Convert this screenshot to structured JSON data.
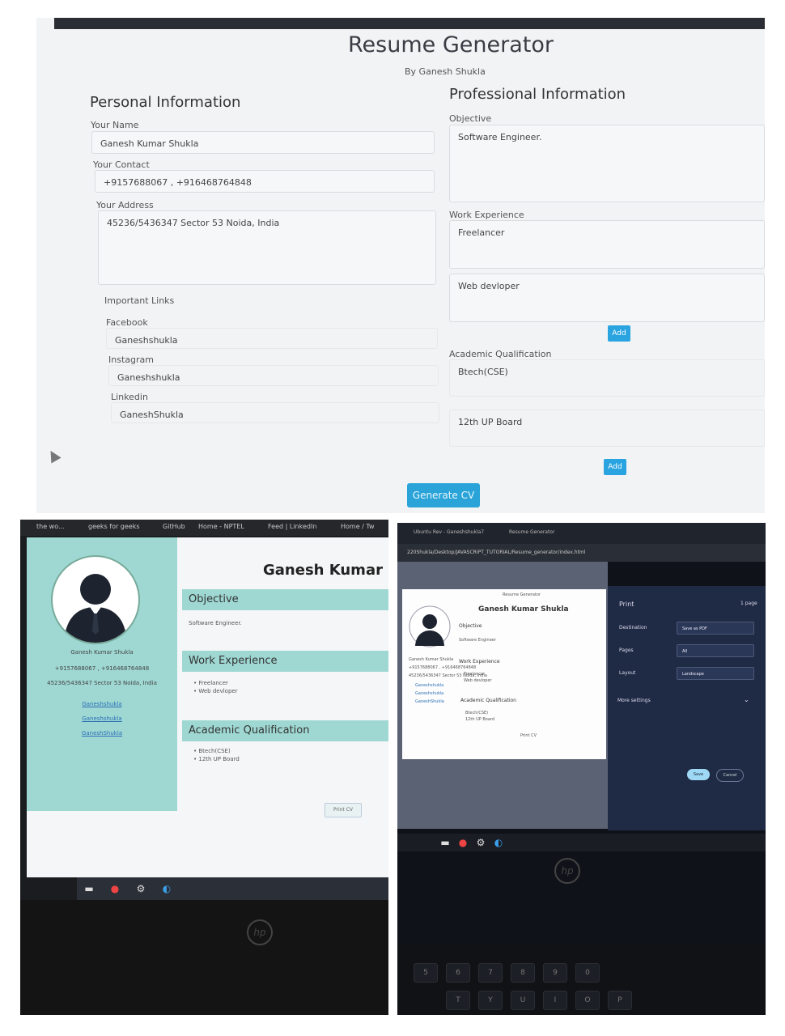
{
  "form": {
    "title": "Resume Generator",
    "subtitle": "By Ganesh Shukla",
    "personal_heading": "Personal Information",
    "professional_heading": "Professional Information",
    "name_label": "Your Name",
    "name_value": "Ganesh Kumar Shukla",
    "contact_label": "Your Contact",
    "contact_value": "+9157688067 , +916468764848",
    "address_label": "Your Address",
    "address_value": "45236/5436347 Sector 53 Noida, India",
    "links_label": "Important Links",
    "facebook_label": "Facebook",
    "facebook_value": "Ganeshshukla",
    "instagram_label": "Instagram",
    "instagram_value": "Ganeshshukla",
    "linkedin_label": "Linkedin",
    "linkedin_value": "GaneshShukla",
    "objective_label": "Objective",
    "objective_value": "Software Engineer.",
    "work_label": "Work Experience",
    "work_values": [
      "Freelancer",
      "Web devloper"
    ],
    "add_label": "Add",
    "academic_label": "Academic Qualification",
    "academic_values": [
      "Btech(CSE)",
      "12th UP Board"
    ],
    "generate_label": "Generate CV"
  },
  "cv_page": {
    "bookmarks": [
      "the wo...",
      "geeks for geeks",
      "GitHub",
      "Home - NPTEL",
      "Feed | LinkedIn",
      "Home / Tw"
    ],
    "name": "Ganesh Kumar S",
    "side_name": "Ganesh Kumar Shukla",
    "side_contact": "+9157688067 , +916468764848",
    "side_address": "45236/5436347 Sector 53 Noida, India",
    "side_links": [
      "Ganeshshukla",
      "Ganeshshukla",
      "GaneshShukla"
    ],
    "objective_heading": "Objective",
    "objective_text": "Software Engineer.",
    "work_heading": "Work Experience",
    "work_items": [
      "Freelancer",
      "Web devloper"
    ],
    "academic_heading": "Academic Qualification",
    "academic_items": [
      "Btech(CSE)",
      "12th UP Board"
    ],
    "print_label": "Print CV"
  },
  "print_dialog": {
    "tab1": "Ubuntu Rev - Ganeshshukla7",
    "tab2": "Resume Generator",
    "url": "220Shukla/Desktop/JAVASCRIPT_TUTORIAL/Resume_generator/index.html",
    "preview_title": "Resume Generator",
    "preview_name": "Ganesh Kumar Shukla",
    "preview_objective": "Objective",
    "preview_objective_text": "Software Engineer",
    "preview_work": "Work Experience",
    "preview_work_items": [
      "Freelancer",
      "Web devloper"
    ],
    "preview_academic": "Academic Qualification",
    "preview_academic_items": [
      "Btech(CSE)",
      "12th UP Board"
    ],
    "preview_side": [
      "Ganesh Kumar Shukla",
      "+9157688067 , +916468764848",
      "45236/5436347 Sector 53 Noida, India",
      "Ganeshshukla",
      "Ganeshshukla",
      "GaneshShukla"
    ],
    "preview_footer": "Print CV",
    "dialog_title": "Print",
    "page_count": "1 page",
    "destination_label": "Destination",
    "destination_value": "Save as PDF",
    "pages_label": "Pages",
    "pages_value": "All",
    "layout_label": "Layout",
    "layout_value": "Landscape",
    "more_settings": "More settings",
    "save_btn": "Save",
    "cancel_btn": "Cancel"
  },
  "colors": {
    "accent_button": "#2aa4e0",
    "cv_teal": "#9fd8d3",
    "dialog_bg": "#1f2a44"
  }
}
